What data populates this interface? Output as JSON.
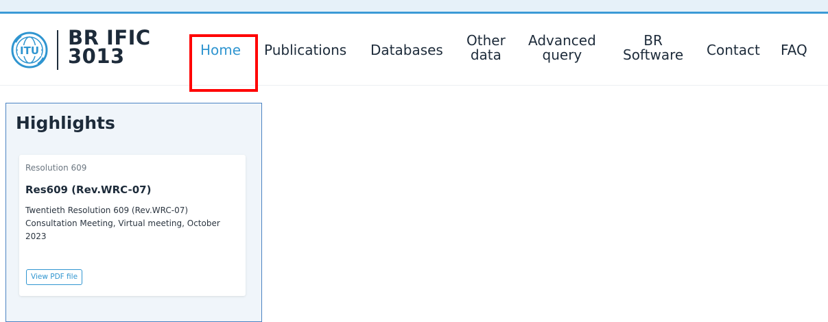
{
  "brand": {
    "line1": "BR IFIC",
    "line2": "3013",
    "logo_icon": "itu-logo-icon",
    "logo_text": "ITU"
  },
  "nav": {
    "home": [
      "Home"
    ],
    "publications": [
      "Publications"
    ],
    "databases": [
      "Databases"
    ],
    "other_data": [
      "Other",
      "data"
    ],
    "advanced_query": [
      "Advanced",
      "query"
    ],
    "br_software": [
      "BR",
      "Software"
    ],
    "contact": [
      "Contact"
    ],
    "faq": [
      "FAQ"
    ]
  },
  "highlights": {
    "title": "Highlights",
    "card": {
      "kicker": "Resolution 609",
      "title": "Res609 (Rev.WRC-07)",
      "description": "Twentieth Resolution 609 (Rev.WRC-07) Consultation Meeting, Virtual meeting, October 2023",
      "button_label": "View PDF file"
    }
  },
  "colors": {
    "accent": "#2f95d0",
    "text": "#1d2b3a",
    "top_band": "#e6f1f9",
    "annotation": "#ff0000"
  }
}
